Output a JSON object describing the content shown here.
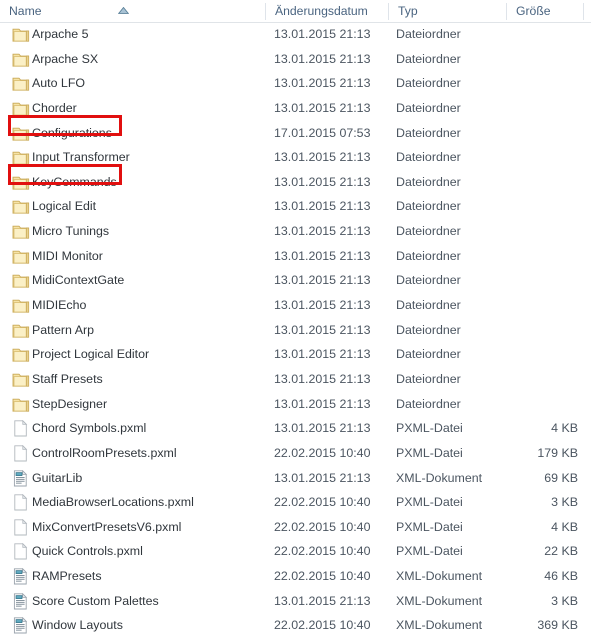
{
  "window": {
    "kind": "file-explorer-list-view",
    "locale": "de-DE"
  },
  "columns": [
    {
      "key": "name",
      "label": "Name",
      "sorted": true,
      "sort_direction": "ascending"
    },
    {
      "key": "date",
      "label": "Änderungsdatum",
      "sorted": false,
      "sort_direction": ""
    },
    {
      "key": "type",
      "label": "Typ",
      "sorted": false,
      "sort_direction": ""
    },
    {
      "key": "size",
      "label": "Größe",
      "sorted": false,
      "sort_direction": ""
    }
  ],
  "icons": {
    "sort_ascending": "sort-ascending-arrow-icon",
    "folder": "folder-icon",
    "pxml_file": "blank-document-icon",
    "xml_document": "xml-document-icon"
  },
  "colors": {
    "annotation": "#e10f0f",
    "header_text": "#4a6480",
    "row_text": "#30363c",
    "folder_body": "#f8e6ab",
    "folder_edge": "#d8b863"
  },
  "rows": [
    {
      "name": "Arpache 5",
      "date": "13.01.2015 21:13",
      "type": "Dateiordner",
      "size": "",
      "icon": "folder",
      "highlight": false
    },
    {
      "name": "Arpache SX",
      "date": "13.01.2015 21:13",
      "type": "Dateiordner",
      "size": "",
      "icon": "folder",
      "highlight": false
    },
    {
      "name": "Auto LFO",
      "date": "13.01.2015 21:13",
      "type": "Dateiordner",
      "size": "",
      "icon": "folder",
      "highlight": false
    },
    {
      "name": "Chorder",
      "date": "13.01.2015 21:13",
      "type": "Dateiordner",
      "size": "",
      "icon": "folder",
      "highlight": false
    },
    {
      "name": "Configurations",
      "date": "17.01.2015 07:53",
      "type": "Dateiordner",
      "size": "",
      "icon": "folder",
      "highlight": true
    },
    {
      "name": "Input Transformer",
      "date": "13.01.2015 21:13",
      "type": "Dateiordner",
      "size": "",
      "icon": "folder",
      "highlight": false
    },
    {
      "name": "KeyCommands",
      "date": "13.01.2015 21:13",
      "type": "Dateiordner",
      "size": "",
      "icon": "folder",
      "highlight": true
    },
    {
      "name": "Logical Edit",
      "date": "13.01.2015 21:13",
      "type": "Dateiordner",
      "size": "",
      "icon": "folder",
      "highlight": false
    },
    {
      "name": "Micro Tunings",
      "date": "13.01.2015 21:13",
      "type": "Dateiordner",
      "size": "",
      "icon": "folder",
      "highlight": false
    },
    {
      "name": "MIDI Monitor",
      "date": "13.01.2015 21:13",
      "type": "Dateiordner",
      "size": "",
      "icon": "folder",
      "highlight": false
    },
    {
      "name": "MidiContextGate",
      "date": "13.01.2015 21:13",
      "type": "Dateiordner",
      "size": "",
      "icon": "folder",
      "highlight": false
    },
    {
      "name": "MIDIEcho",
      "date": "13.01.2015 21:13",
      "type": "Dateiordner",
      "size": "",
      "icon": "folder",
      "highlight": false
    },
    {
      "name": "Pattern Arp",
      "date": "13.01.2015 21:13",
      "type": "Dateiordner",
      "size": "",
      "icon": "folder",
      "highlight": false
    },
    {
      "name": "Project Logical Editor",
      "date": "13.01.2015 21:13",
      "type": "Dateiordner",
      "size": "",
      "icon": "folder",
      "highlight": false
    },
    {
      "name": "Staff Presets",
      "date": "13.01.2015 21:13",
      "type": "Dateiordner",
      "size": "",
      "icon": "folder",
      "highlight": false
    },
    {
      "name": "StepDesigner",
      "date": "13.01.2015 21:13",
      "type": "Dateiordner",
      "size": "",
      "icon": "folder",
      "highlight": false
    },
    {
      "name": "Chord Symbols.pxml",
      "date": "13.01.2015 21:13",
      "type": "PXML-Datei",
      "size": "4 KB",
      "icon": "pxml_file",
      "highlight": false
    },
    {
      "name": "ControlRoomPresets.pxml",
      "date": "22.02.2015 10:40",
      "type": "PXML-Datei",
      "size": "179 KB",
      "icon": "pxml_file",
      "highlight": false
    },
    {
      "name": "GuitarLib",
      "date": "13.01.2015 21:13",
      "type": "XML-Dokument",
      "size": "69 KB",
      "icon": "xml_document",
      "highlight": false
    },
    {
      "name": "MediaBrowserLocations.pxml",
      "date": "22.02.2015 10:40",
      "type": "PXML-Datei",
      "size": "3 KB",
      "icon": "pxml_file",
      "highlight": false
    },
    {
      "name": "MixConvertPresetsV6.pxml",
      "date": "22.02.2015 10:40",
      "type": "PXML-Datei",
      "size": "4 KB",
      "icon": "pxml_file",
      "highlight": false
    },
    {
      "name": "Quick Controls.pxml",
      "date": "22.02.2015 10:40",
      "type": "PXML-Datei",
      "size": "22 KB",
      "icon": "pxml_file",
      "highlight": false
    },
    {
      "name": "RAMPresets",
      "date": "22.02.2015 10:40",
      "type": "XML-Dokument",
      "size": "46 KB",
      "icon": "xml_document",
      "highlight": false
    },
    {
      "name": "Score Custom Palettes",
      "date": "13.01.2015 21:13",
      "type": "XML-Dokument",
      "size": "3 KB",
      "icon": "xml_document",
      "highlight": false
    },
    {
      "name": "Window Layouts",
      "date": "22.02.2015 10:40",
      "type": "XML-Dokument",
      "size": "369 KB",
      "icon": "xml_document",
      "highlight": false
    }
  ]
}
